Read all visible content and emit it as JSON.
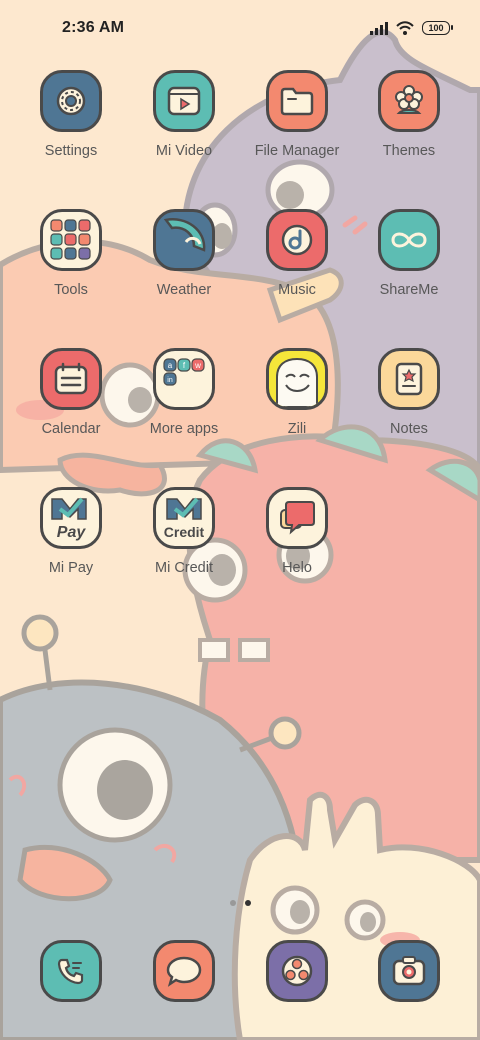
{
  "status": {
    "time": "2:36 AM",
    "battery": "100",
    "icons": [
      "signal-icon",
      "wifi-icon",
      "battery-icon"
    ]
  },
  "apps": {
    "settings": "Settings",
    "mi_video": "Mi Video",
    "file_manager": "File Manager",
    "themes": "Themes",
    "tools": "Tools",
    "weather": "Weather",
    "music": "Music",
    "shareme": "ShareMe",
    "calendar": "Calendar",
    "more_apps": "More apps",
    "zili": "Zili",
    "notes": "Notes",
    "mi_pay": "Mi Pay",
    "mi_credit": "Mi Credit",
    "helo": "Helo"
  },
  "tile_text": {
    "pay": "Pay",
    "credit": "Credit"
  },
  "dock": {
    "icons": [
      "phone-icon",
      "messages-icon",
      "browser-icon",
      "camera-icon"
    ]
  },
  "pages": {
    "count": 2,
    "current": 2
  },
  "colors": {
    "blue": "#4f7694",
    "teal": "#5dbdb3",
    "coral": "#f3896f",
    "red": "#ec6b6b",
    "purple": "#7c6fa8",
    "cream": "#fdf3dc",
    "outline": "#4a4a4a"
  }
}
